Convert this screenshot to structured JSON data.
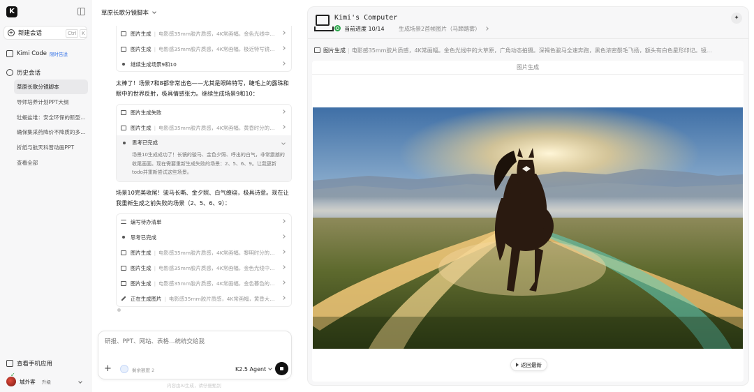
{
  "sidebar": {
    "logo": "K",
    "new_chat": "新建会话",
    "shortcut_ctrl": "Ctrl",
    "shortcut_k": "K",
    "kimi_code": "Kimi Code",
    "kimi_code_badge": "限时告送",
    "history_title": "历史会话",
    "history": [
      "草原长歌分镜脚本",
      "导师培养计划PPT大纲",
      "牡蛎盐堆：安全环保的新型…",
      "确保集采药降价不降质的多…",
      "折纸与航天科普动画PPT",
      "查看全部"
    ],
    "mobile_app": "查看手机应用",
    "user_name": "城外客",
    "upgrade": "升级"
  },
  "chat": {
    "title": "草原长歌分镜脚本",
    "card1": [
      {
        "kind": "图片生成",
        "desc": "电影感35mm胶片质感，4K常画幅，金色光线中…"
      },
      {
        "kind": "图片生成",
        "desc": "电影感35mm胶片质感，4K常画幅，极近特写镜…"
      },
      {
        "kind": "继续生成场景9和10",
        "desc": ""
      }
    ],
    "msg1": "太棒了！场景7和8都非常出色——尤其是眼眸特写，睫毛上的露珠和眼中的世界反射，极具情感张力。继续生成场景9和10：",
    "card2": [
      {
        "kind": "图片生成失败",
        "desc": ""
      },
      {
        "kind": "图片生成",
        "desc": "电影感35mm胶片质感，4K常画幅，黄昏时分的…"
      }
    ],
    "think_title": "思考已完成",
    "think_body": "场景10生成成功了！长镜的骏马、金色夕照、呼出的白气，非常震撼的收尾画面。现在需要重新生成失败的场景：2、5、6、9。让我更新todo并重新尝试这些场景。",
    "msg2": "场景10完美收尾！骏马长嘶、金夕照、白气缭绕，极具诗意。现在让我重新生成之前失败的场景（2、5、6、9）：",
    "card3": [
      {
        "kind": "编写待办清单",
        "desc": ""
      },
      {
        "kind": "思考已完成",
        "desc": ""
      },
      {
        "kind": "图片生成",
        "desc": "电影感35mm胶片质感，4K常画幅，黎明时分的…"
      },
      {
        "kind": "图片生成",
        "desc": "电影感35mm胶片质感，4K常画幅，金色光线中…"
      },
      {
        "kind": "图片生成",
        "desc": "电影感35mm胶片质感，4K常画幅，金色暮色的…"
      },
      {
        "kind": "正在生成图片",
        "desc": "电影感35mm胶片质感，4K常画幅，黄昏大…"
      }
    ],
    "composer_placeholder": "研报、PPT、网站、表格…统统交给我",
    "credit": "剩余额度 2",
    "model": "K2.5 Agent",
    "disclaimer": "内容由AI生成，请仔细甄别"
  },
  "computer": {
    "title": "Kimi's Computer",
    "progress_label": "当前进度 10/14",
    "progress_step": "生成场景2首帧图片（马蹄踏雾）",
    "step_kind": "图片生成",
    "step_desc": "电影感35mm胶片质感，4K常画幅。金色光线中的大草原，广角动态拍摄。深褐色骏马全速奔跑，黑色浓密鬃毛飞扬，额头有白色星形印记。镜…",
    "viewer_title": "图片生成",
    "back_button": "返回最新"
  },
  "colors": {
    "accent": "#2e6ee6",
    "progress_green": "#2aa64a",
    "stop_button": "#111111"
  }
}
